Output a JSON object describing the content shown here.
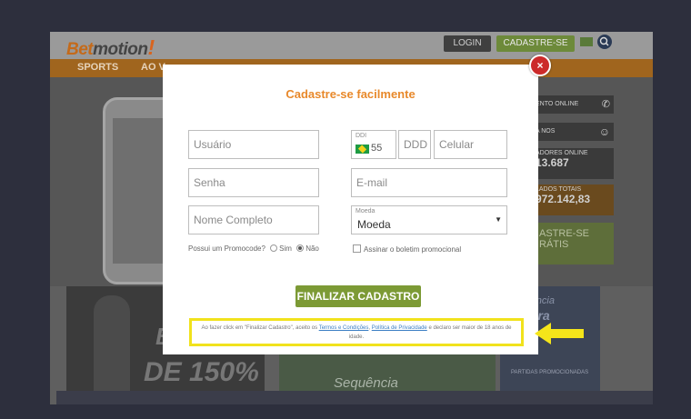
{
  "site": {
    "logo": {
      "bet": "Bet",
      "motion": "motion",
      "bang": "!"
    },
    "header": {
      "login_label": "LOGIN",
      "register_label": "CADASTRE-SE"
    },
    "nav": {
      "items": [
        "SPORTS",
        "AO V"
      ]
    },
    "sidebar": {
      "online_label": "ENTO ONLINE",
      "nos_label": "A NOS",
      "players_label": "ADORES ONLINE",
      "players_value": "13.687",
      "totals_label": "LADOS TOTAIS",
      "totals_value": "972.142,83",
      "cta_line1": "ASTRE-SE",
      "cta_line2": "RÁTIS"
    },
    "banners": {
      "left_letter": "B",
      "left_text": "DE 150%",
      "mid_text": "Sequência",
      "right_line1": "Sequência",
      "right_line2": "hadora",
      "right_line3": "PARTIDAS PROMOCIONADAS"
    }
  },
  "modal": {
    "title": "Cadastre-se facilmente",
    "fields": {
      "username_placeholder": "Usuário",
      "ddi_label": "DDI",
      "ddi_value": "55",
      "ddd_placeholder": "DDD",
      "phone_placeholder": "Celular",
      "password_placeholder": "Senha",
      "email_placeholder": "E-mail",
      "fullname_placeholder": "Nome Completo",
      "currency_label": "Moeda",
      "currency_value": "Moeda"
    },
    "promo": {
      "question": "Possui um Promocode?",
      "yes": "Sim",
      "no": "Não",
      "selected": "no"
    },
    "newsletter_label": "Assinar o boletim promocional",
    "submit_label": "FINALIZAR CADASTRO",
    "terms": {
      "prefix": "Ao fazer click em \"Finalizar Cadastro\", aceito os",
      "terms_link": "Termos e Condições",
      "sep": ",",
      "privacy_link": "Política de Privacidade",
      "suffix": "e declaro ser maior de 18 anos de idade."
    },
    "close_icon": "×"
  },
  "colors": {
    "accent": "#e8892b",
    "submit": "#7c9a35",
    "highlight": "#f1e21c",
    "close": "#cc2a2a",
    "link": "#3b7fc4"
  },
  "icons": [
    "close-icon",
    "search-icon",
    "flag-icon",
    "phone-icon",
    "smile-icon",
    "highlight-arrow-icon",
    "brazil-flag-icon",
    "chevron-down-icon"
  ]
}
